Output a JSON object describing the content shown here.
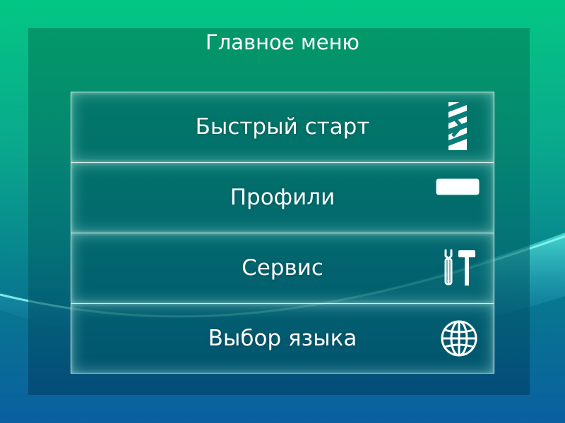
{
  "main_menu": {
    "title": "Главное меню",
    "items": [
      {
        "label": "Быстрый старт",
        "icon": "quick-start-icon"
      },
      {
        "label": "Профили",
        "icon": "profile-card-icon"
      },
      {
        "label": "Сервис",
        "icon": "wrench-hammer-icon"
      },
      {
        "label": "Выбор языка",
        "icon": "globe-icon"
      }
    ]
  },
  "colors": {
    "background_top": "#04c684",
    "background_bottom": "#0a5fa0",
    "text": "#ffffff",
    "border": "#ffffff"
  }
}
